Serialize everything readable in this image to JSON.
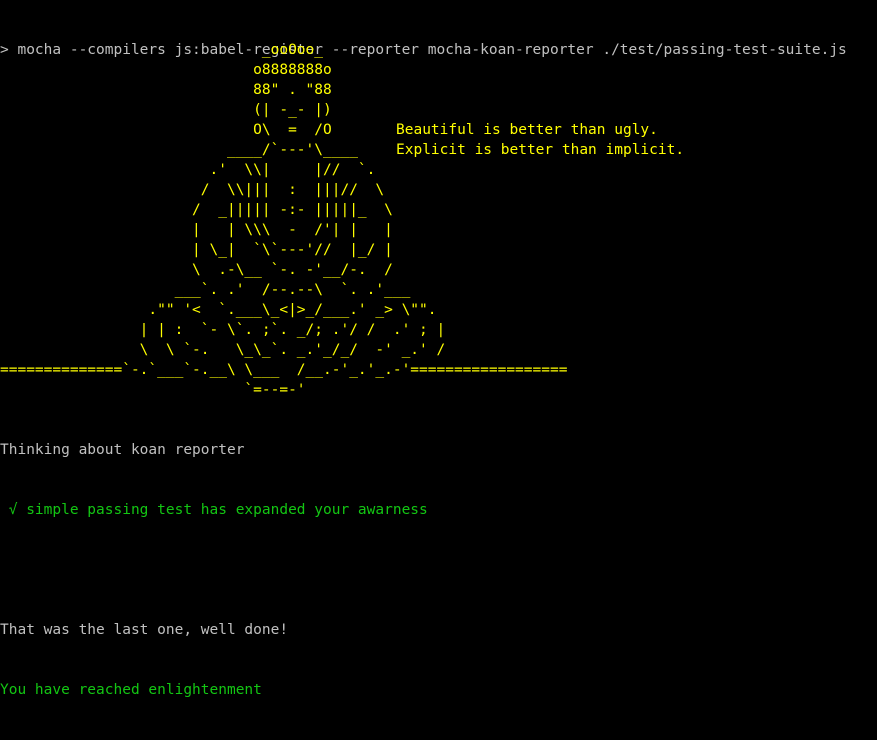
{
  "colors": {
    "background": "#000000",
    "default": "#c0c0c0",
    "art": "#ffff00",
    "quote": "#ffff00",
    "pass": "#13c613",
    "enlightenment": "#13c613"
  },
  "command": "> mocha --compilers js:babel-register --reporter mocha-koan-reporter ./test/passing-test-suite.js",
  "art": "                              _ooOoo_\n                             o8888888o\n                             88\" . \"88\n                             (| -_- |)\n                             O\\  =  /O\n                          ____/`---'\\____\n                        .'  \\\\|     |//  `.\n                       /  \\\\|||  :  |||//  \\\n                      /  _||||| -:- |||||_  \\\n                      |   | \\\\\\  -  /'| |   |\n                      | \\_|  `\\`---'//  |_/ |\n                      \\  .-\\__ `-. -'__/-.  /\n                    ___`. .'  /--.--\\  `. .'___\n                 .\"\" '<  `.___\\_<|>_/___.' _> \\\"\".\n                | | :  `- \\`. ;`. _/; .'/ /  .' ; |\n                \\  \\ `-.   \\_\\_`. _.'_/_/  -' _.' /\n==============`-.`___`-.__\\ \\___  /__.-'_.'_.-'==================\n                            `=--=-'",
  "quote": [
    "Beautiful is better than ugly.",
    "Explicit is better than implicit."
  ],
  "output": {
    "thinking": "Thinking about koan reporter",
    "pass_line": " √ simple passing test has expanded your awarness",
    "last_one": "That was the last one, well done!",
    "enlightenment": "You have reached enlightenment"
  }
}
